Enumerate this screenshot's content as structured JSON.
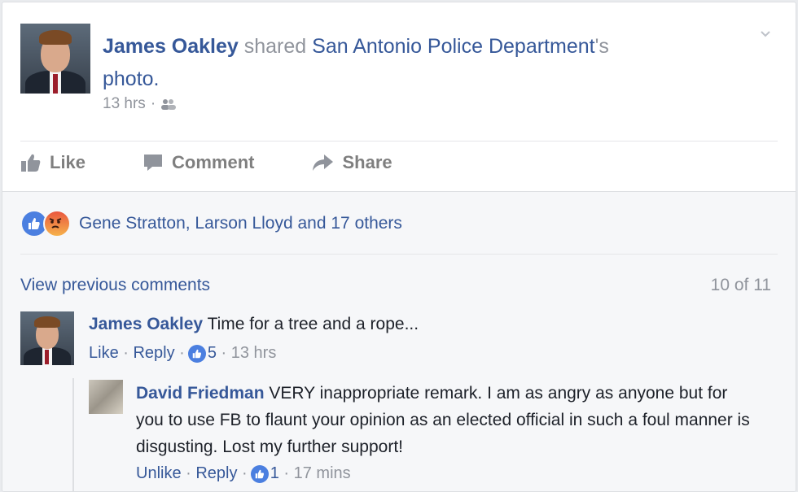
{
  "post": {
    "author": "James Oakley",
    "verb": " shared ",
    "shared_source": "San Antonio Police Department",
    "possessive": "'s",
    "object": "photo.",
    "time": "13 hrs",
    "separator": " · "
  },
  "actions": {
    "like": "Like",
    "comment": "Comment",
    "share": "Share"
  },
  "reactions": {
    "summary": "Gene Stratton, Larson Lloyd and 17 others"
  },
  "comments_header": {
    "view_previous": "View previous comments",
    "counter": "10 of 11"
  },
  "comment1": {
    "author": "James Oakley",
    "text": " Time for a tree and a rope...",
    "like": "Like",
    "reply": "Reply",
    "like_count": "5",
    "time": "13 hrs"
  },
  "comment2": {
    "author": "David Friedman",
    "text": " VERY inappropriate remark. I am as angry as anyone but for you to use FB to flaunt your opinion as an elected official in such a foul manner is disgusting. Lost my further support!",
    "unlike": "Unlike",
    "reply": "Reply",
    "like_count": "1",
    "time": "17 mins"
  },
  "colors": {
    "link": "#365899",
    "muted": "#90949c",
    "like_blue": "#4b7fe0"
  }
}
